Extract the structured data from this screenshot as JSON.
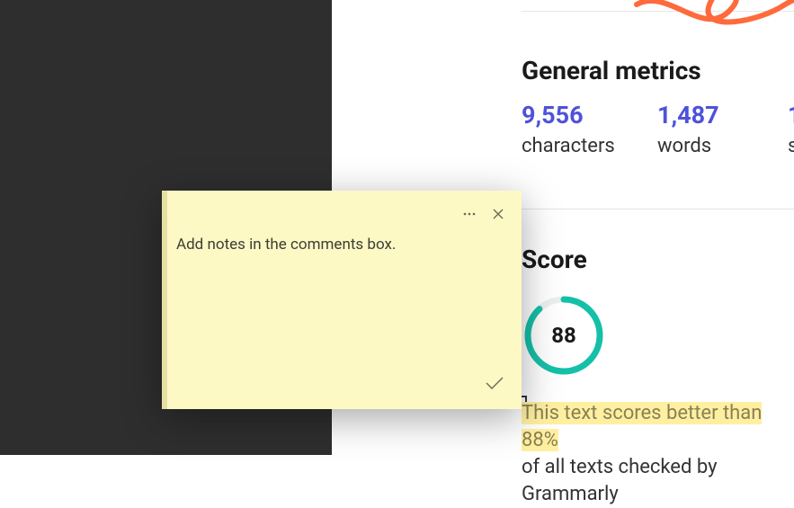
{
  "metrics": {
    "heading": "General metrics",
    "items": [
      {
        "value": "9,556",
        "label": "characters"
      },
      {
        "value": "1,487",
        "label": "words"
      },
      {
        "value": "1",
        "label": "s"
      }
    ]
  },
  "score": {
    "heading": "Score",
    "value": "88",
    "percent": 88
  },
  "bottom": {
    "highlighted": "This text scores better than 88%",
    "rest": "of all texts checked by Grammarly"
  },
  "note": {
    "placeholder": "Add notes in the comments box."
  },
  "accent_color": "#ff6a3d",
  "score_color": "#15c0a8"
}
